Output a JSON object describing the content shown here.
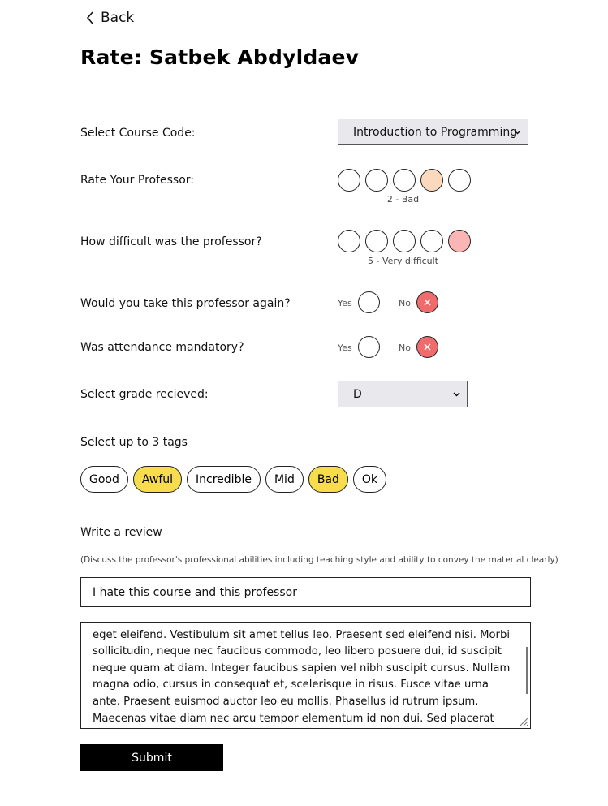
{
  "nav": {
    "back_label": "Back"
  },
  "page": {
    "title": "Rate: Satbek Abdyldaev"
  },
  "course": {
    "label": "Select Course Code:",
    "selected": "Introduction to Programming"
  },
  "rating": {
    "label": "Rate Your Professor:",
    "selected": 4,
    "caption": "2 - Bad",
    "highlight": "#fcd8bc"
  },
  "difficulty": {
    "label": "How difficult was the professor?",
    "selected": 5,
    "caption": "5 - Very difficult",
    "highlight": "#fcb5b5"
  },
  "take_again": {
    "label": "Would you take this professor again?",
    "yes_label": "Yes",
    "no_label": "No",
    "value": "No"
  },
  "attendance": {
    "label": "Was attendance mandatory?",
    "yes_label": "Yes",
    "no_label": "No",
    "value": "No"
  },
  "grade": {
    "label": "Select grade recieved:",
    "selected": "D"
  },
  "tags": {
    "label": "Select up to 3 tags",
    "items": [
      {
        "label": "Good",
        "selected": false
      },
      {
        "label": "Awful",
        "selected": true
      },
      {
        "label": "Incredible",
        "selected": false
      },
      {
        "label": "Mid",
        "selected": false
      },
      {
        "label": "Bad",
        "selected": true
      },
      {
        "label": "Ok",
        "selected": false
      }
    ],
    "selected_color": "#f7dc4e"
  },
  "review": {
    "label": "Write a review",
    "hint": "(Discuss the professor's professional abilities including teaching style and ability to convey the material clearly)",
    "title_value": "I hate this course and this professor",
    "body_value": "Lorem ipsum dolor sit amet, consectetur adipiscing elit. Nullam tincidunt felis eget eleifend. Vestibulum sit amet tellus leo. Praesent sed eleifend nisi. Morbi sollicitudin, neque nec faucibus commodo, leo libero posuere dui, id suscipit neque quam at diam. Integer faucibus sapien vel nibh suscipit cursus. Nullam magna odio, cursus in consequat et, scelerisque in risus. Fusce vitae urna ante. Praesent euismod auctor leo eu mollis. Phasellus id rutrum ipsum. Maecenas vitae diam nec arcu tempor elementum id non dui. Sed placerat lectus velit, in malesuada velit aliquam quis."
  },
  "submit": {
    "label": "Submit"
  },
  "icons": {
    "back": "chevron-left-icon",
    "select_arrow": "chevron-down-icon",
    "no_mark": "x-icon",
    "resize": "resize-grip-icon"
  }
}
